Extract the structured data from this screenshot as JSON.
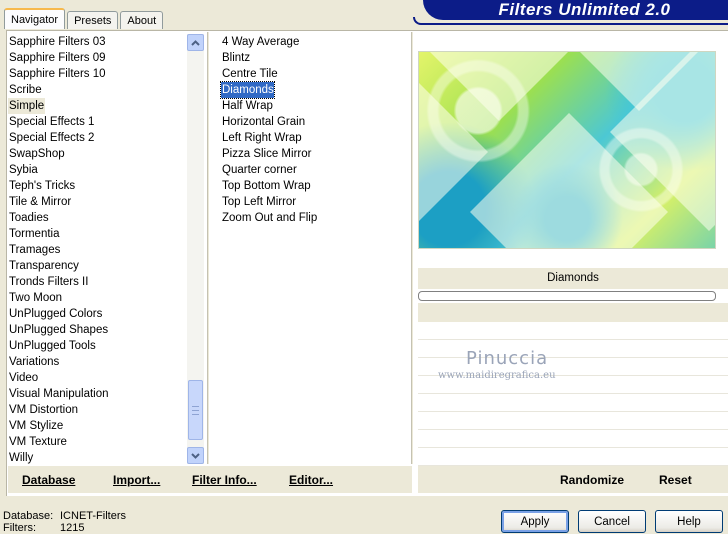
{
  "window": {
    "title": "Filters Unlimited 2.0"
  },
  "tabs": [
    {
      "label": "Navigator",
      "active": true
    },
    {
      "label": "Presets",
      "active": false
    },
    {
      "label": "About",
      "active": false
    }
  ],
  "categories": [
    "Sapphire Filters 03",
    "Sapphire Filters 09",
    "Sapphire Filters 10",
    "Scribe",
    "Simple",
    "Special Effects 1",
    "Special Effects 2",
    "SwapShop",
    "Sybia",
    "Teph's Tricks",
    "Tile & Mirror",
    "Toadies",
    "Tormentia",
    "Tramages",
    "Transparency",
    "Tronds Filters II",
    "Two Moon",
    "UnPlugged Colors",
    "UnPlugged Shapes",
    "UnPlugged Tools",
    "Variations",
    "Video",
    "Visual Manipulation",
    "VM Distortion",
    "VM Stylize",
    "VM Texture",
    "Willy"
  ],
  "selected_category": "Simple",
  "filters": [
    "4 Way Average",
    "Blintz",
    "Centre Tile",
    "Diamonds",
    "Half Wrap",
    "Horizontal Grain",
    "Left Right Wrap",
    "Pizza Slice Mirror",
    "Quarter corner",
    "Top Bottom Wrap",
    "Top Left Mirror",
    "Zoom Out and Flip"
  ],
  "selected_filter": "Diamonds",
  "preview": {
    "filter_name": "Diamonds",
    "watermark_name": "Pinuccia",
    "watermark_url": "www.maidiregrafica.eu"
  },
  "toolbar": {
    "database": "Database",
    "import": "Import...",
    "filter_info": "Filter Info...",
    "editor": "Editor...",
    "randomize": "Randomize",
    "reset": "Reset"
  },
  "footer": {
    "database_label": "Database:",
    "database_value": "ICNET-Filters",
    "filters_label": "Filters:",
    "filters_value": "1215"
  },
  "buttons": {
    "apply": "Apply",
    "cancel": "Cancel",
    "help": "Help"
  },
  "colors": {
    "selection": "#316ac5",
    "banner": "#0c1c88",
    "dialog_bg": "#ece9d8"
  }
}
